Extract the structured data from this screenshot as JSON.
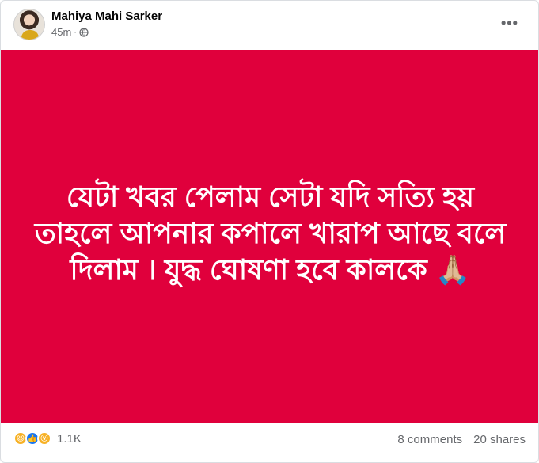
{
  "post": {
    "author": "Mahiya Mahi Sarker",
    "time": "45m",
    "separator": "·",
    "privacy_icon": "globe-icon",
    "more_icon": "more-options-icon",
    "more_label": "•••",
    "background_color": "#e0003c",
    "text_line1": "যেটা খবর পেলাম সেটা যদি সত্যি হয়",
    "text_line2": "তাহলে আপনার কপালে খারাপ আছে বলে",
    "text_line3": "দিলাম । যুদ্ধ ঘোষণা হবে কালকে 🙏🏼"
  },
  "footer": {
    "reaction_icons": [
      "haha-icon",
      "like-icon",
      "wow-icon"
    ],
    "reaction_count": "1.1K",
    "comments": "8 comments",
    "shares": "20 shares"
  }
}
